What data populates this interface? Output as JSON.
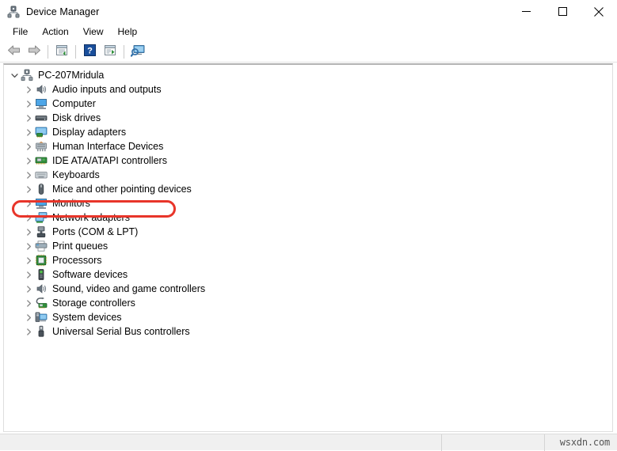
{
  "window": {
    "title": "Device Manager",
    "title_icon": "device-manager-icon",
    "controls": {
      "minimize": "minimize-icon",
      "maximize": "maximize-icon",
      "close": "close-icon"
    }
  },
  "menubar": {
    "items": [
      {
        "label": "File"
      },
      {
        "label": "Action"
      },
      {
        "label": "View"
      },
      {
        "label": "Help"
      }
    ]
  },
  "toolbar": {
    "buttons": [
      {
        "name": "back-button",
        "icon": "left-arrow-icon"
      },
      {
        "name": "forward-button",
        "icon": "right-arrow-icon"
      },
      {
        "name": "separator-1",
        "icon": "separator"
      },
      {
        "name": "properties-button",
        "icon": "properties-icon"
      },
      {
        "name": "separator-2",
        "icon": "separator"
      },
      {
        "name": "help-button",
        "icon": "question-mark-icon"
      },
      {
        "name": "update-driver-button",
        "icon": "update-driver-icon"
      },
      {
        "name": "separator-3",
        "icon": "separator"
      },
      {
        "name": "scan-hardware-button",
        "icon": "scan-hardware-icon"
      }
    ]
  },
  "tree": {
    "root": {
      "label": "PC-207Mridula",
      "icon": "computer-tree-icon",
      "expanded": true,
      "chevron": "chevron-down-icon"
    },
    "items": [
      {
        "label": "Audio inputs and outputs",
        "icon": "speaker-icon",
        "chevron": "chevron-right-icon",
        "highlighted": false
      },
      {
        "label": "Computer",
        "icon": "monitor-icon",
        "chevron": "chevron-right-icon",
        "highlighted": false
      },
      {
        "label": "Disk drives",
        "icon": "disk-drive-icon",
        "chevron": "chevron-right-icon",
        "highlighted": false
      },
      {
        "label": "Display adapters",
        "icon": "display-adapter-icon",
        "chevron": "chevron-right-icon",
        "highlighted": false
      },
      {
        "label": "Human Interface Devices",
        "icon": "hid-icon",
        "chevron": "chevron-right-icon",
        "highlighted": true
      },
      {
        "label": "IDE ATA/ATAPI controllers",
        "icon": "ide-controller-icon",
        "chevron": "chevron-right-icon",
        "highlighted": false
      },
      {
        "label": "Keyboards",
        "icon": "keyboard-icon",
        "chevron": "chevron-right-icon",
        "highlighted": false
      },
      {
        "label": "Mice and other pointing devices",
        "icon": "mouse-icon",
        "chevron": "chevron-right-icon",
        "highlighted": false
      },
      {
        "label": "Monitors",
        "icon": "monitor-icon",
        "chevron": "chevron-right-icon",
        "highlighted": false
      },
      {
        "label": "Network adapters",
        "icon": "network-adapter-icon",
        "chevron": "chevron-right-icon",
        "highlighted": false
      },
      {
        "label": "Ports (COM & LPT)",
        "icon": "port-icon",
        "chevron": "chevron-right-icon",
        "highlighted": false
      },
      {
        "label": "Print queues",
        "icon": "printer-icon",
        "chevron": "chevron-right-icon",
        "highlighted": false
      },
      {
        "label": "Processors",
        "icon": "processor-icon",
        "chevron": "chevron-right-icon",
        "highlighted": false
      },
      {
        "label": "Software devices",
        "icon": "software-device-icon",
        "chevron": "chevron-right-icon",
        "highlighted": false
      },
      {
        "label": "Sound, video and game controllers",
        "icon": "speaker-icon",
        "chevron": "chevron-right-icon",
        "highlighted": false
      },
      {
        "label": "Storage controllers",
        "icon": "storage-controller-icon",
        "chevron": "chevron-right-icon",
        "highlighted": false
      },
      {
        "label": "System devices",
        "icon": "system-device-icon",
        "chevron": "chevron-right-icon",
        "highlighted": false
      },
      {
        "label": "Universal Serial Bus controllers",
        "icon": "usb-icon",
        "chevron": "chevron-right-icon",
        "highlighted": false
      }
    ]
  },
  "annotation": {
    "target_label": "Human Interface Devices",
    "shape": "rounded-rectangle",
    "color": "#e8352a"
  },
  "statusbar": {
    "pane_1": "",
    "pane_2": "",
    "watermark": "wsxdn.com"
  }
}
